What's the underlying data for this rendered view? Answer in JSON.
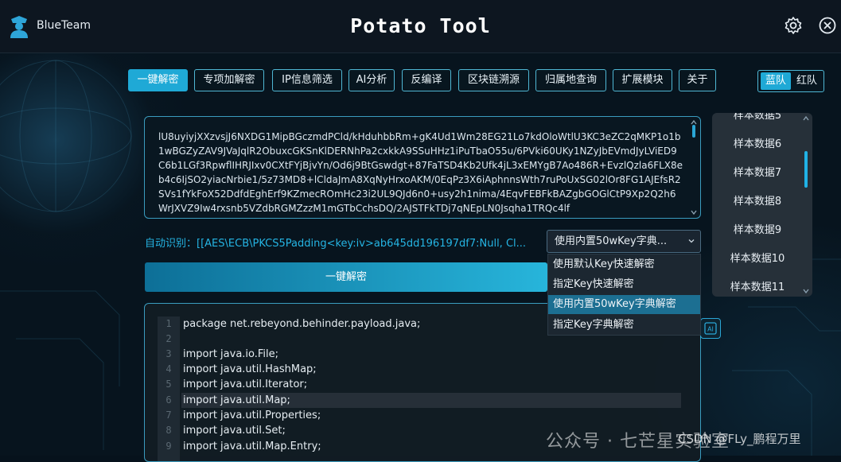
{
  "titlebar": {
    "brand": "BlueTeam",
    "app_title": "Potato Tool",
    "settings_icon": "gear-icon",
    "close_icon": "close-icon"
  },
  "tabs": [
    {
      "label": "一键解密",
      "active": true
    },
    {
      "label": "专项加解密",
      "active": false
    },
    {
      "label": "IP信息筛选",
      "active": false
    },
    {
      "label": "AI分析",
      "active": false
    },
    {
      "label": "反编译",
      "active": false
    },
    {
      "label": "区块链溯源",
      "active": false
    },
    {
      "label": "归属地查询",
      "active": false
    },
    {
      "label": "扩展模块",
      "active": false
    },
    {
      "label": "关于",
      "active": false
    }
  ],
  "team": {
    "blue": "蓝队",
    "red": "红队",
    "selected": "蓝队"
  },
  "input": {
    "text": "lU8uyiyjXXzvsjJ6NXDG1MipBGczmdPCld/kHduhbbRm+gK4Ud1Wm28EG21Lo7kdOloWtlU3KC3eZC2qMKP1o1b1wBGZyZAV9JVaJqlR2ObuxcGKSnKlDERNhPa2cxkkA9SSuHHz1iPuTbaO55u/6PVki60UKy1NZyJbEVmdJyLViED9C6b1LGf3RpwflIHRJIxv0CXtFYjBjvYn/Od6j9BtGswdgt+87FaTSD4Kb2Ufk4jL3xEMYgB7Ao486R+EvzlQzla6FLX8eb4c6IjSO2yiacNrbie1/5z73MD8+lCldaJmA8XqNyHrxoAKM/0EqPz3X6iAphnnsWth7ruPoUxSG02lOr8FG1AJEfsR2SVs1fYkFoX52DdfdEghErf9KZmecROmHc23i2UL9QJd6n0+usy2h1nima/4EqvFEBFkBAZgbGOGlCtP9Xp2Q2h6WrJXVZ9Iw4rxsnb5VZdbRGMZzzM1mGTbCchsDQ/2AJSTFkTDj7qNEpLN0Jsqha1TRQc4lf"
  },
  "samples": [
    "样本数据5",
    "样本数据6",
    "样本数据7",
    "样本数据8",
    "样本数据9",
    "样本数据10",
    "样本数据11"
  ],
  "detect": {
    "label": "自动识别：",
    "value": "[[AES\\ECB\\PKCS5Padding<key:iv>ab645dd196197df7:Null, Cl..."
  },
  "mode": {
    "selected": "使用内置50wKey字典...",
    "options": [
      "使用默认Key快速解密",
      "指定Key快速解密",
      "使用内置50wKey字典解密",
      "指定Key字典解密"
    ],
    "highlighted_index": 2
  },
  "decode_button": "一键解密",
  "code": {
    "lines": [
      "package net.rebeyond.behinder.payload.java;",
      "",
      "import java.io.File;",
      "import java.util.HashMap;",
      "import java.util.Iterator;",
      "import java.util.Map;",
      "import java.util.Properties;",
      "import java.util.Set;",
      "import java.util.Map.Entry;"
    ],
    "line_numbers": [
      "1",
      "2",
      "3",
      "4",
      "5",
      "6",
      "7",
      "8",
      "9"
    ],
    "highlighted_line": 6
  },
  "ai_button": "AI",
  "watermark": "公众号 · 七芒星实验室",
  "csdn": "CSDN @FLy_鹏程万里"
}
